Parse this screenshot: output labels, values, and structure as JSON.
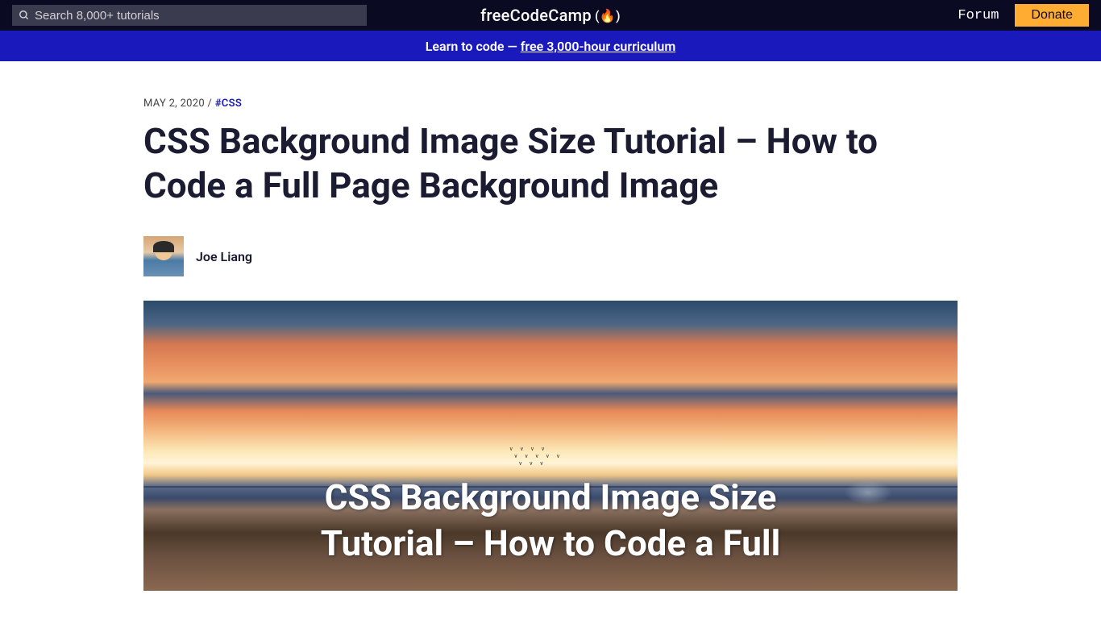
{
  "nav": {
    "search_placeholder": "Search 8,000+ tutorials",
    "logo_text": "freeCodeCamp",
    "forum_label": "Forum",
    "donate_label": "Donate"
  },
  "banner": {
    "prefix": "Learn to code — ",
    "link_text": "free 3,000-hour curriculum"
  },
  "article": {
    "date": "MAY 2, 2020",
    "separator": " / ",
    "tag": "#CSS",
    "title": "CSS Background Image Size Tutorial – How to Code a Full Page Background Image",
    "author": "Joe Liang",
    "hero_text_line1": "CSS Background Image Size",
    "hero_text_line2": "Tutorial – How to Code a Full"
  }
}
